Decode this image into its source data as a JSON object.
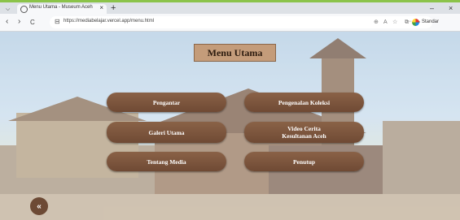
{
  "browser": {
    "tab_title": "Menu Utama - Museum Aceh",
    "tab_close": "×",
    "new_tab": "+",
    "chevron": "⌵",
    "url": "https://mediabelajar.vercel.app/menu.html",
    "profile_label": "Standar",
    "minimize": "–",
    "close": "×",
    "back": "‹",
    "forward": "›",
    "reload": "C",
    "more": "···",
    "icons": [
      "tab-search-icon",
      "read-aloud-icon",
      "favorite-icon",
      "collections-icon",
      "profile-icon"
    ]
  },
  "page": {
    "title": "Menu Utama",
    "buttons": [
      {
        "label": "Pengantar"
      },
      {
        "label": "Pengenalan Koleksi"
      },
      {
        "label": "Galeri Utama"
      },
      {
        "label": "Video Cerita Kesultanan Aceh"
      },
      {
        "label": "Tentang Media"
      },
      {
        "label": "Penutup"
      }
    ],
    "back_button": "«"
  },
  "colors": {
    "button_fill": "#7a543c",
    "title_fill": "#c49c7a",
    "accent_strip": "#8bc34a"
  }
}
